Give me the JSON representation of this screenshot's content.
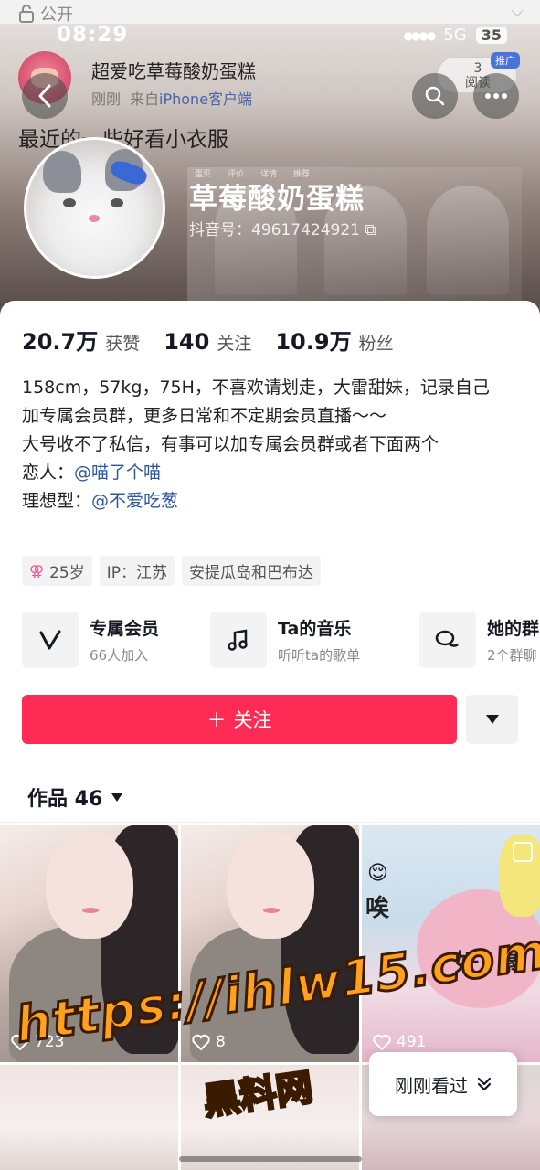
{
  "top_strip": {
    "label": "公开"
  },
  "status_bar": {
    "time": "08:29",
    "network": "5G",
    "battery": "35"
  },
  "post": {
    "author": "超爱吃草莓酸奶蛋糕",
    "time": "刚刚",
    "from_prefix": "来自",
    "client": "iPhone客户端",
    "reads_count": "3",
    "reads_label": "阅读",
    "promo_badge": "推广",
    "caption": "最近的一些好看小衣服"
  },
  "profile": {
    "nickname": "草莓酸奶蛋糕",
    "douyin_id": "抖音号：49617424921",
    "banner_tabs": [
      "蛋贝",
      "评价",
      "详情",
      "推荐"
    ]
  },
  "stats": [
    {
      "value": "20.7万",
      "label": "获赞"
    },
    {
      "value": "140",
      "label": "关注"
    },
    {
      "value": "10.9万",
      "label": "粉丝"
    }
  ],
  "bio": {
    "line1": "158cm，57kg，75H，不喜欢请划走，大雷甜妹，记录自己",
    "line2": "加专属会员群，更多日常和不定期会员直播～～",
    "line3": "大号收不了私信，有事可以加专属会员群或者下面两个",
    "lover_label": "恋人：",
    "lover_mention": "@喵了个喵",
    "ideal_label": "理想型：",
    "ideal_mention": "@不爱吃葱"
  },
  "tags": {
    "age": "25岁",
    "ip": "IP：江苏",
    "location": "安提瓜岛和巴布达"
  },
  "entries": [
    {
      "title": "专属会员",
      "subtitle": "66人加入",
      "icon": "v-icon"
    },
    {
      "title": "Ta的音乐",
      "subtitle": "听听ta的歌单",
      "icon": "music-note-icon"
    },
    {
      "title": "她的群",
      "subtitle": "2个群聊",
      "icon": "chat-group-icon"
    }
  ],
  "follow": {
    "label": "关注"
  },
  "works": {
    "label": "作品 46"
  },
  "videos": [
    {
      "likes": "723"
    },
    {
      "likes": "8"
    },
    {
      "likes": "491"
    }
  ],
  "comic_text": {
    "a": "唉",
    "b": "好",
    "c": "累"
  },
  "recent": {
    "label": "刚刚看过"
  },
  "watermark": {
    "url": "https://ihlw15.com",
    "site": "黑料网"
  },
  "colors": {
    "accent": "#fe2c55",
    "mention": "#2c57a0",
    "promo": "#4a73d9"
  }
}
